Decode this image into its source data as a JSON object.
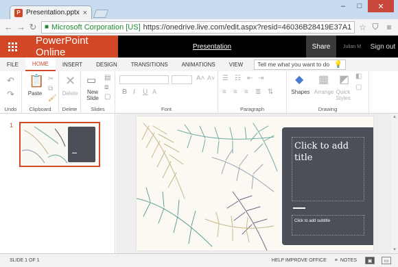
{
  "browser": {
    "tab_title": "Presentation.pptx - Micro",
    "url_company": "Microsoft Corporation [US]",
    "url": "https://onedrive.live.com/edit.aspx?resid=46036B28419E37A1!150&a"
  },
  "header": {
    "app_name": "PowerPoint Online",
    "doc_name": "Presentation",
    "share": "Share",
    "user": "Julian M",
    "sign_out": "Sign out"
  },
  "ribbon_tabs": [
    "FILE",
    "HOME",
    "INSERT",
    "DESIGN",
    "TRANSITIONS",
    "ANIMATIONS",
    "VIEW"
  ],
  "tell_me": "Tell me what you want to do",
  "groups": {
    "undo": "Undo",
    "clipboard": "Clipboard",
    "delete": "Delete",
    "slides": "Slides",
    "font": "Font",
    "paragraph": "Paragraph",
    "drawing": "Drawing"
  },
  "buttons": {
    "paste": "Paste",
    "delete": "Delete",
    "new_slide": "New Slide",
    "shapes": "Shapes",
    "arrange": "Arrange",
    "quick_styles": "Quick Styles"
  },
  "slide": {
    "number": "1",
    "title_placeholder": "Click to add title",
    "subtitle_placeholder": "Click to add subtitle"
  },
  "status": {
    "slide_count": "SLIDE 1 OF 1",
    "help": "HELP IMPROVE OFFICE",
    "notes": "NOTES"
  },
  "colors": {
    "accent": "#d24726",
    "panel": "#4d4f58"
  }
}
